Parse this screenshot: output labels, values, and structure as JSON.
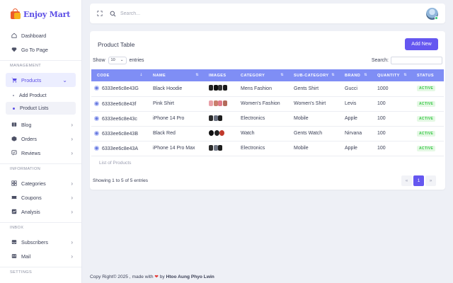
{
  "brand": {
    "name": "Enjoy Mart"
  },
  "sidebar": {
    "top_items": [
      {
        "label": "Dashboard",
        "icon": "home-icon"
      },
      {
        "label": "Go To Page",
        "icon": "diamond-icon"
      }
    ],
    "sections": {
      "management": "MANAGEMENT",
      "information": "INFORMATION",
      "inbox": "INBOX",
      "settings": "SETTINGS"
    },
    "products": {
      "label": "Products",
      "sub": [
        "Add Product",
        "Product Lists"
      ]
    },
    "management_items": [
      {
        "label": "Blog"
      },
      {
        "label": "Orders"
      },
      {
        "label": "Reviews"
      }
    ],
    "information_items": [
      {
        "label": "Categories"
      },
      {
        "label": "Coupons"
      },
      {
        "label": "Analysis"
      }
    ],
    "inbox_items": [
      {
        "label": "Subscribers"
      },
      {
        "label": "Mail"
      }
    ]
  },
  "topbar": {
    "search_placeholder": "Search..."
  },
  "card": {
    "title": "Product Table",
    "add_button": "Add New",
    "show_label": "Show",
    "show_value": "10",
    "entries_label": "entries",
    "search_label": "Search:"
  },
  "table": {
    "columns": [
      "CODE",
      "NAME",
      "IMAGES",
      "CATEGORY",
      "SUB-CATEGORY",
      "BRAND",
      "QUANTITY",
      "STATUS"
    ],
    "rows": [
      {
        "code": "6333ee6c8e43G",
        "name": "Black Hoodie",
        "category": "Mens Fashion",
        "subcategory": "Gents Shirt",
        "brand": "Gucci",
        "quantity": "1000",
        "status": "ACTIVE"
      },
      {
        "code": "6333ee6c8e43f",
        "name": "Pink Shirt",
        "category": "Women's Fashion",
        "subcategory": "Women's Shirt",
        "brand": "Levis",
        "quantity": "100",
        "status": "ACTIVE"
      },
      {
        "code": "6333ee6c8e43c",
        "name": "iPhone 14 Pro",
        "category": "Electronics",
        "subcategory": "Mobile",
        "brand": "Apple",
        "quantity": "100",
        "status": "ACTIVE"
      },
      {
        "code": "6333ee6c8e43B",
        "name": "Black Red",
        "category": "Watch",
        "subcategory": "Gents Watch",
        "brand": "Nirvana",
        "quantity": "100",
        "status": "ACTIVE"
      },
      {
        "code": "6333ee6c8e43A",
        "name": "iPhone 14 Pro Max",
        "category": "Electronics",
        "subcategory": "Mobile",
        "brand": "Apple",
        "quantity": "100",
        "status": "ACTIVE"
      }
    ],
    "caption": "List of Products",
    "showing": "Showing 1 to 5 of 5 entries"
  },
  "pager": {
    "prev": "«",
    "current": "1",
    "next": "»"
  },
  "footer": {
    "prefix": "Copy Right© 2025 , made with",
    "by": "by",
    "author": "Htoo Aung Phyo Lwin"
  },
  "colors": {
    "accent": "#6557f0",
    "header": "#7f8ef5",
    "active_badge": "#3cc84a"
  }
}
